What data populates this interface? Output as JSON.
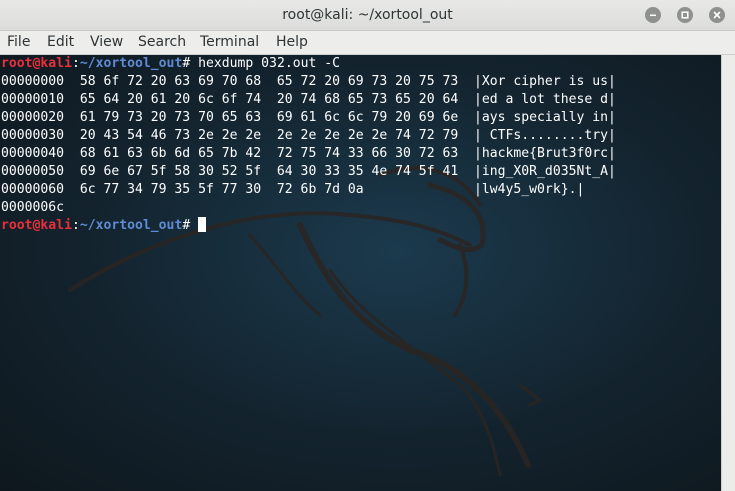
{
  "window": {
    "title": "root@kali: ~/xortool_out",
    "controls": {
      "minimize_icon": "minimize-icon",
      "maximize_icon": "maximize-icon",
      "close_icon": "close-icon"
    }
  },
  "menubar": {
    "items": [
      {
        "label": "File"
      },
      {
        "label": "Edit"
      },
      {
        "label": "View"
      },
      {
        "label": "Search"
      },
      {
        "label": "Terminal"
      },
      {
        "label": "Help"
      }
    ]
  },
  "terminal": {
    "prompt": {
      "user_host": "root@kali",
      "separator": ":",
      "path": "~/xortool_out",
      "symbol": "# "
    },
    "command": "hexdump 032.out -C",
    "output": [
      "00000000  58 6f 72 20 63 69 70 68  65 72 20 69 73 20 75 73  |Xor cipher is us|",
      "00000010  65 64 20 61 20 6c 6f 74  20 74 68 65 73 65 20 64  |ed a lot these d|",
      "00000020  61 79 73 20 73 70 65 63  69 61 6c 6c 79 20 69 6e  |ays specially in|",
      "00000030  20 43 54 46 73 2e 2e 2e  2e 2e 2e 2e 2e 74 72 79  | CTFs........try|",
      "00000040  68 61 63 6b 6d 65 7b 42  72 75 74 33 66 30 72 63  |hackme{Brut3f0rc|",
      "00000050  69 6e 67 5f 58 30 52 5f  64 30 33 35 4e 74 5f 41  |ing_X0R_d035Nt_A|",
      "00000060  6c 77 34 79 35 5f 77 30  72 6b 7d 0a              |lw4y5_w0rk}.|",
      "0000006c"
    ],
    "colors": {
      "user_host": "#e8303a",
      "path": "#5f8bd4",
      "text": "#ffffff",
      "background": "#13232e"
    }
  }
}
